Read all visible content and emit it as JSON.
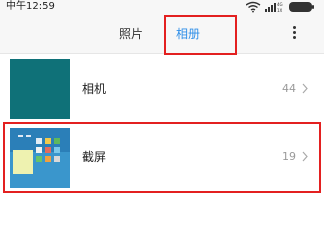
{
  "status_bar": {
    "time": "中午12:59",
    "signal_label": "4G",
    "network_label": "1X"
  },
  "tabs": [
    {
      "label": "照片",
      "active": false
    },
    {
      "label": "相册",
      "active": true
    }
  ],
  "albums": [
    {
      "name": "相机",
      "count": "44"
    },
    {
      "name": "截屏",
      "count": "19"
    }
  ],
  "colors": {
    "accent": "#2f8fe8",
    "highlight": "#e32020",
    "camera_thumb": "#0f7178",
    "screenshot_thumb": "#2b7fb8"
  },
  "icons": {
    "wifi": "wifi-icon",
    "signal": "signal-icon",
    "battery": "battery-icon",
    "more": "more-vertical-icon",
    "chevron": "chevron-right-icon"
  }
}
